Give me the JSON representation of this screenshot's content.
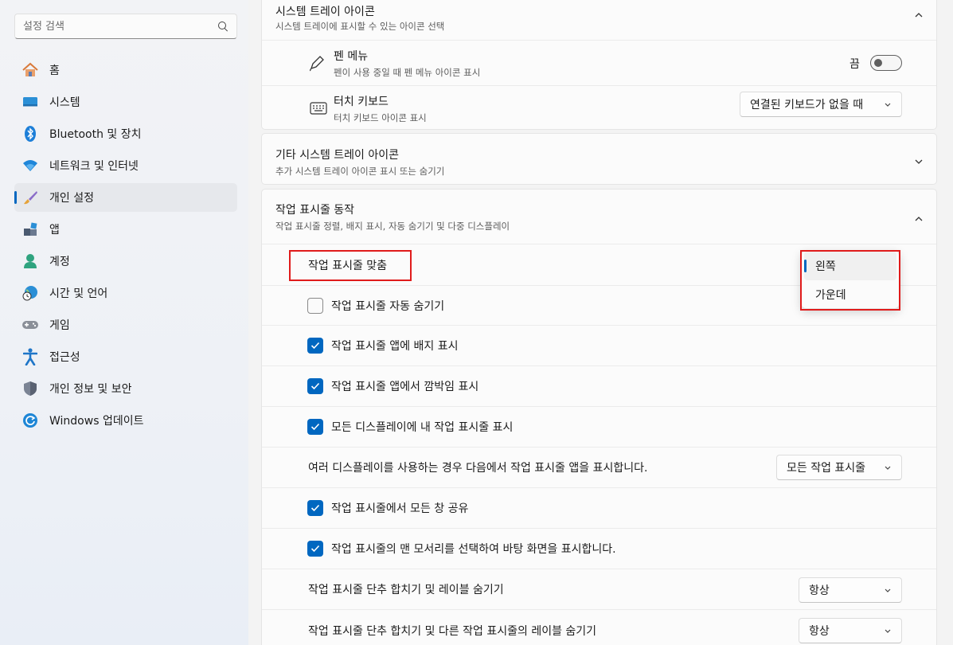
{
  "search": {
    "placeholder": "설정 검색"
  },
  "sidebar": {
    "items": [
      {
        "label": "홈",
        "icon": "home-icon"
      },
      {
        "label": "시스템",
        "icon": "system-icon"
      },
      {
        "label": "Bluetooth 및 장치",
        "icon": "bluetooth-icon"
      },
      {
        "label": "네트워크 및 인터넷",
        "icon": "wifi-icon"
      },
      {
        "label": "개인 설정",
        "icon": "brush-icon",
        "active": true
      },
      {
        "label": "앱",
        "icon": "apps-icon"
      },
      {
        "label": "계정",
        "icon": "account-icon"
      },
      {
        "label": "시간 및 언어",
        "icon": "globe-clock-icon"
      },
      {
        "label": "게임",
        "icon": "gamepad-icon"
      },
      {
        "label": "접근성",
        "icon": "accessibility-icon"
      },
      {
        "label": "개인 정보 및 보안",
        "icon": "shield-icon"
      },
      {
        "label": "Windows 업데이트",
        "icon": "update-icon"
      }
    ]
  },
  "tray": {
    "title": "시스템 트레이 아이콘",
    "subtitle": "시스템 트레이에 표시할 수 있는 아이콘 선택",
    "pen": {
      "title": "펜 메뉴",
      "subtitle": "펜이 사용 중일 때 펜 메뉴 아이콘 표시",
      "toggle_label": "끔"
    },
    "touch": {
      "title": "터치 키보드",
      "subtitle": "터치 키보드 아이콘 표시",
      "value": "연결된 키보드가 없을 때"
    }
  },
  "other_tray": {
    "title": "기타 시스템 트레이 아이콘",
    "subtitle": "추가 시스템 트레이 아이콘 표시 또는 숨기기"
  },
  "behaviors": {
    "title": "작업 표시줄 동작",
    "subtitle": "작업 표시줄 정렬, 배지 표시, 자동 숨기기 및 다중 디스플레이",
    "alignment_label": "작업 표시줄 맞춤",
    "alignment_options": [
      "왼쪽",
      "가운데"
    ],
    "auto_hide": "작업 표시줄 자동 숨기기",
    "badges": "작업 표시줄 앱에 배지 표시",
    "flashing": "작업 표시줄 앱에서 깜박임 표시",
    "all_displays": "모든 디스플레이에 내 작업 표시줄 표시",
    "multi_display_label": "여러 디스플레이를 사용하는 경우 다음에서 작업 표시줄 앱을 표시합니다.",
    "multi_display_value": "모든 작업 표시줄",
    "share_window": "작업 표시줄에서 모든 창 공유",
    "corner_desktop": "작업 표시줄의 맨 모서리를 선택하여 바탕 화면을 표시합니다.",
    "combine_label": "작업 표시줄 단추 합치기 및 레이블 숨기기",
    "combine_value": "항상",
    "combine_other_label": "작업 표시줄 단추 합치기 및 다른 작업 표시줄의 레이블 숨기기",
    "combine_other_value": "항상"
  },
  "colors": {
    "accent": "#0067c0",
    "highlight": "#e01b1b"
  }
}
